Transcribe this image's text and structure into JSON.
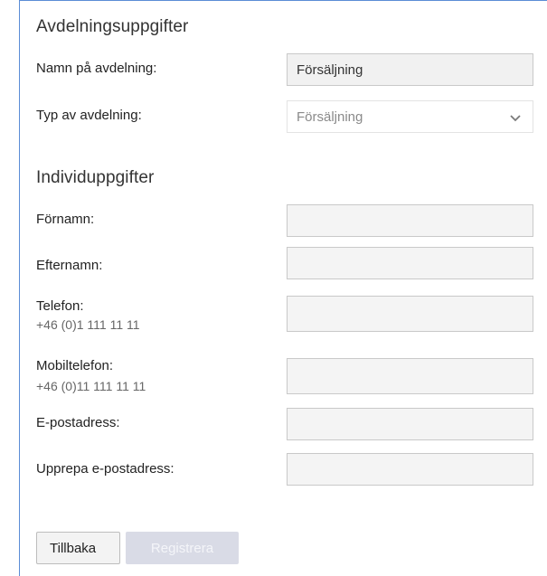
{
  "department": {
    "title": "Avdelningsuppgifter",
    "name_label": "Namn på avdelning:",
    "name_value": "Försäljning",
    "type_label": "Typ av avdelning:",
    "type_value": "Försäljning",
    "type_icon": "chevron-down-icon"
  },
  "individual": {
    "title": "Individuppgifter",
    "first_name_label": "Förnamn:",
    "first_name_value": "",
    "last_name_label": "Efternamn:",
    "last_name_value": "",
    "phone_label": "Telefon:",
    "phone_hint": "+46 (0)1 111 11 11",
    "phone_value": "",
    "mobile_label": "Mobiltelefon:",
    "mobile_hint": "+46 (0)11 111 11 11",
    "mobile_value": "",
    "email_label": "E-postadress:",
    "email_value": "",
    "email_repeat_label": "Upprepa e-postadress:",
    "email_repeat_value": ""
  },
  "actions": {
    "back_label": "Tillbaka",
    "register_label": "Registrera"
  },
  "colors": {
    "panel_border": "#5b8dd6",
    "disabled_button": "#d9dbe6"
  }
}
